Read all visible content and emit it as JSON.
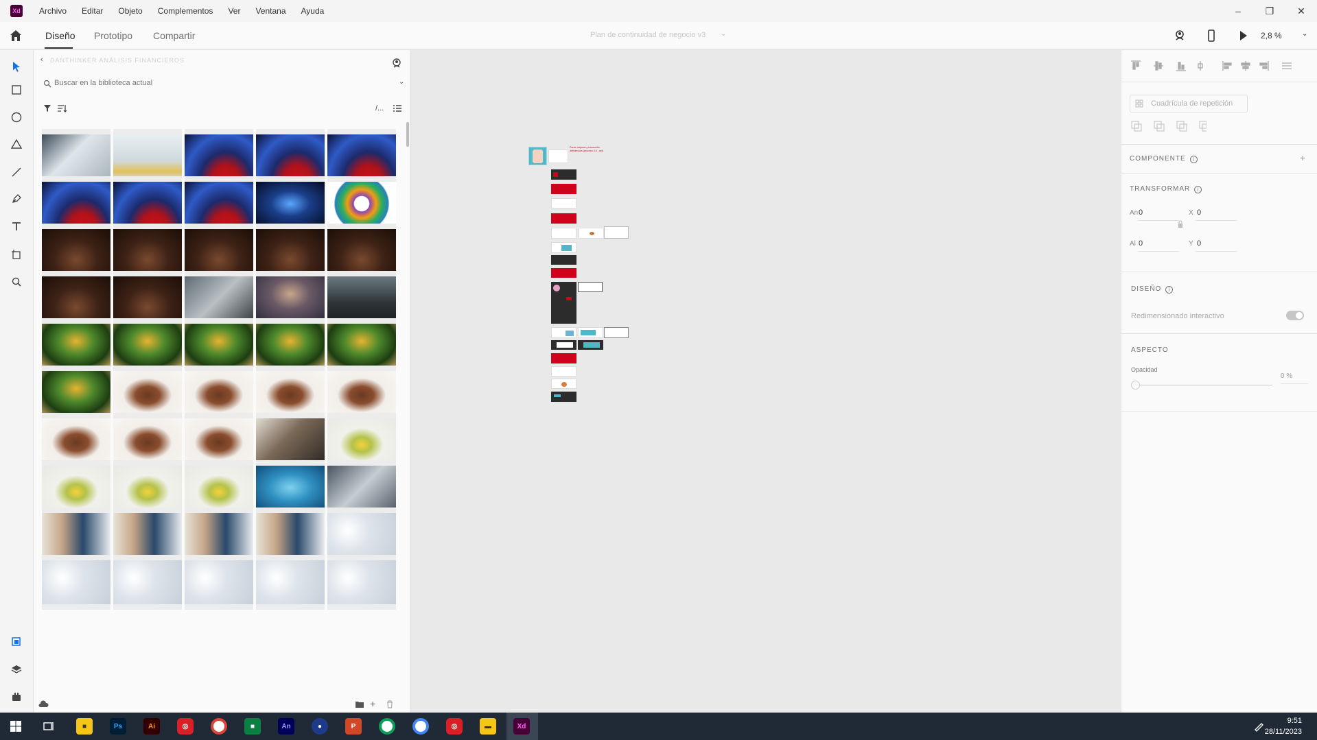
{
  "app": {
    "logo": "Xd",
    "logo_color": "#470137"
  },
  "menu": [
    "Archivo",
    "Editar",
    "Objeto",
    "Complementos",
    "Ver",
    "Ventana",
    "Ayuda"
  ],
  "window_controls": {
    "minimize": "–",
    "restore": "❐",
    "close": "✕"
  },
  "toolbar": {
    "tabs": [
      "Diseño",
      "Prototipo",
      "Compartir"
    ],
    "active_tab": "Diseño",
    "document_title": "Plan de continuidad de negocio v3",
    "zoom": "2,8 %"
  },
  "tools": [
    "select-icon",
    "rectangle-icon",
    "ellipse-icon",
    "polygon-icon",
    "line-icon",
    "pen-icon",
    "text-icon",
    "artboard-icon",
    "zoom-icon",
    "libraries-icon",
    "layers-icon",
    "plugins-icon"
  ],
  "library": {
    "title": "DANTHINKER ANÁLISIS FINANCIEROS",
    "search_placeholder": "Buscar en la biblioteca actual",
    "thumbnails": [
      [
        "laptop",
        "coins",
        "gauge",
        "gauge",
        "gauge"
      ],
      [
        "gauge",
        "gauge",
        "gauge",
        "xray",
        "wheel"
      ],
      [
        "coffee",
        "coffee",
        "coffee",
        "coffee",
        "coffee"
      ],
      [
        "coffee",
        "coffee",
        "tablet",
        "people",
        "meeting"
      ],
      [
        "tree",
        "tree",
        "tree",
        "tree",
        "tree"
      ],
      [
        "tree",
        "cake",
        "cake",
        "cake",
        "cake"
      ],
      [
        "cake",
        "cake",
        "cake",
        "robot",
        "lemon"
      ],
      [
        "lemon",
        "lemon",
        "lemon",
        "surgery",
        "bw"
      ],
      [
        "office",
        "office",
        "office",
        "office",
        "sparkle"
      ],
      [
        "sparkle",
        "sparkle",
        "sparkle",
        "sparkle",
        "sparkle"
      ]
    ]
  },
  "inspector": {
    "repeat_grid": "Cuadrícula de repetición",
    "component_title": "COMPONENTE",
    "transform_title": "TRANSFORMAR",
    "width_label": "An",
    "width": "0",
    "height_label": "Al",
    "height": "0",
    "x_label": "X",
    "x": "0",
    "y_label": "Y",
    "y": "0",
    "design_title": "DISEÑO",
    "responsive_resize": "Redimensionado interactivo",
    "appearance_title": "ASPECTO",
    "opacity_label": "Opacidad",
    "opacity": "0 %"
  },
  "canvas": {
    "headline": "Poner mejoras y corrección deficiencias (proceso 4.4 - act)"
  },
  "taskbar": {
    "apps": [
      "windows",
      "task-view",
      "sticky-notes",
      "Ps",
      "Ai",
      "creative-cloud",
      "chrome",
      "teams",
      "An",
      "app-blue",
      "powerpoint",
      "chrome-2",
      "chrome-3",
      "creative-cloud-2",
      "explorer",
      "Xd"
    ],
    "time": "9:51",
    "date": "28/11/2023"
  },
  "colors": {
    "accent": "#1473e6",
    "xd_pink": "#ff61f6",
    "slide_red": "#d0021b"
  }
}
